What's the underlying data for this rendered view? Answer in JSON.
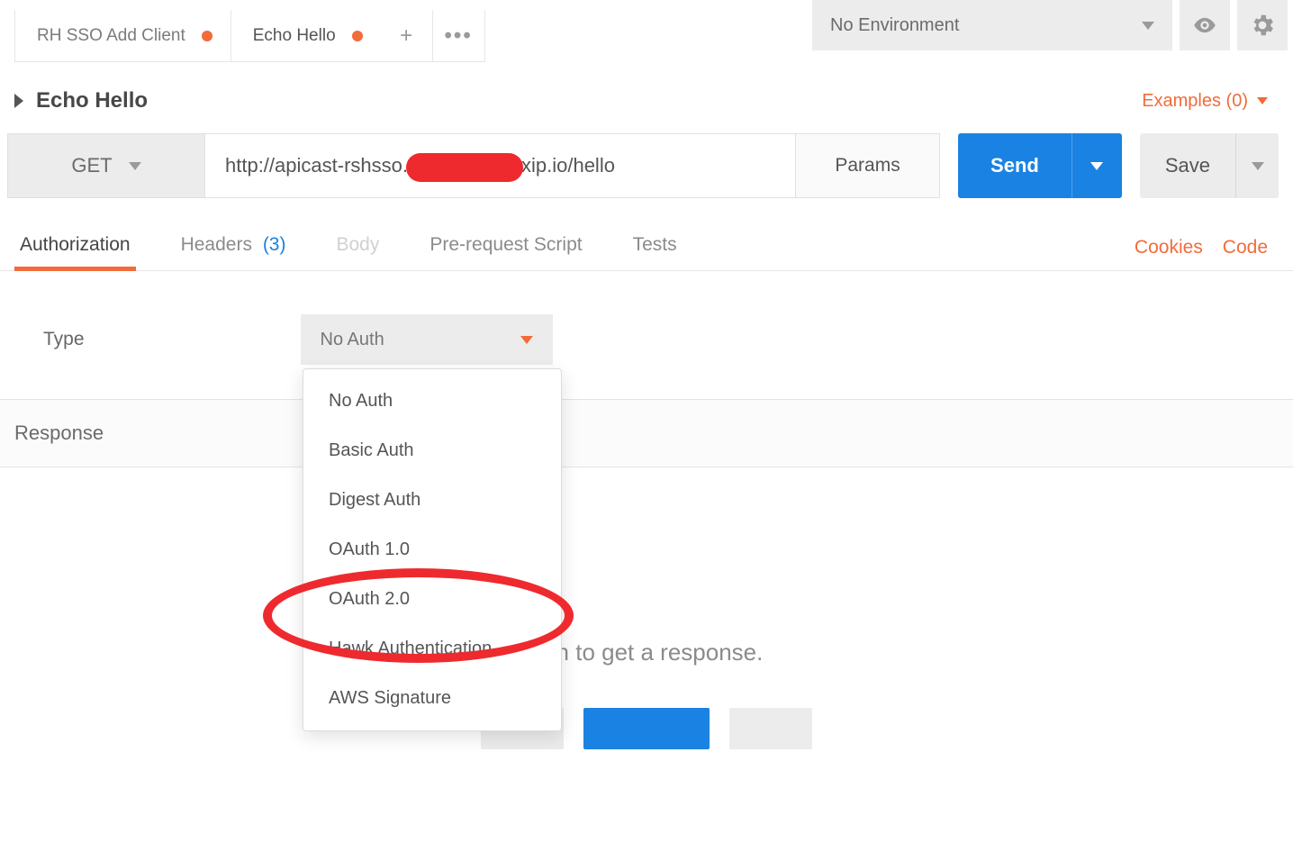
{
  "tabs": [
    {
      "label": "RH SSO Add Client",
      "dirty": true,
      "active": false
    },
    {
      "label": "Echo Hello",
      "dirty": true,
      "active": true
    }
  ],
  "environment": {
    "selected": "No Environment"
  },
  "request": {
    "name": "Echo Hello",
    "examples_label": "Examples (0)",
    "method": "GET",
    "url_prefix": "http://apicast-rshsso.",
    "url_suffix": "xip.io/hello",
    "params_label": "Params",
    "send_label": "Send",
    "save_label": "Save"
  },
  "request_tabs": {
    "authorization": "Authorization",
    "headers_label": "Headers",
    "headers_count": "(3)",
    "body": "Body",
    "prerequest": "Pre-request Script",
    "tests": "Tests",
    "cookies": "Cookies",
    "code": "Code"
  },
  "auth": {
    "type_label": "Type",
    "selected": "No Auth",
    "options": [
      "No Auth",
      "Basic Auth",
      "Digest Auth",
      "OAuth 1.0",
      "OAuth 2.0",
      "Hawk Authentication",
      "AWS Signature"
    ],
    "highlighted": "OAuth 2.0"
  },
  "response": {
    "header": "Response",
    "hint_visible_fragment": "tton to get a response."
  },
  "colors": {
    "accent": "#f26b3a",
    "primary": "#1a82e2",
    "annotation": "#ee2a2e"
  }
}
